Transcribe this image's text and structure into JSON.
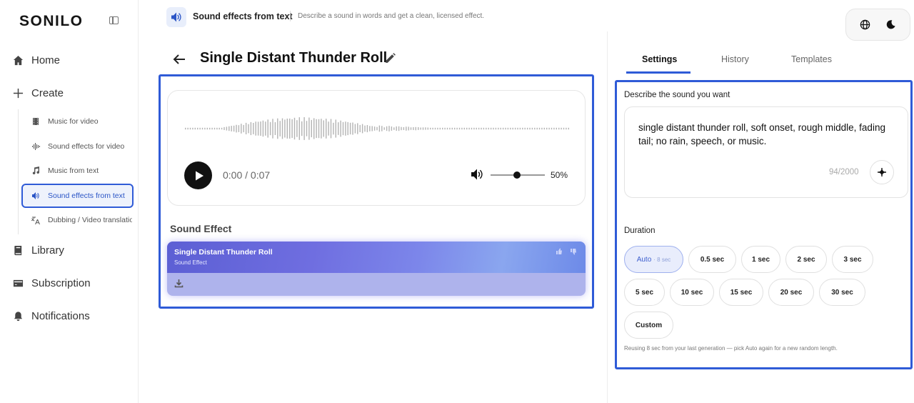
{
  "sidebar": {
    "logo": "SONILO",
    "home": "Home",
    "create": "Create",
    "sub_items": [
      {
        "label": "Music for video"
      },
      {
        "label": "Sound effects for video"
      },
      {
        "label": "Music from text"
      },
      {
        "label": "Sound effects from text"
      },
      {
        "label": "Dubbing / Video translation"
      }
    ],
    "library": "Library",
    "subscription": "Subscription",
    "notifications": "Notifications"
  },
  "header": {
    "title": "Sound effects from text",
    "description": "Describe a sound in words and get a clean, licensed effect."
  },
  "main": {
    "title": "Single Distant Thunder Roll",
    "player": {
      "time": "0:00 / 0:07",
      "volume_label": "50%",
      "volume": 0.5
    },
    "section_label": "Sound Effect",
    "card": {
      "name": "Single Distant Thunder Roll",
      "type": "Sound Effect"
    }
  },
  "panel": {
    "tabs": [
      "Settings",
      "History",
      "Templates"
    ],
    "active_tab": "Settings",
    "describe_label": "Describe the sound you want",
    "prompt": "single distant thunder roll, soft onset, rough middle, fading tail; no rain, speech, or music.",
    "char_count": "94/2000",
    "duration_label": "Duration",
    "auto_label": "Auto",
    "auto_sub": "· 8 sec",
    "durations": [
      "0.5 sec",
      "1 sec",
      "2 sec",
      "3 sec",
      "5 sec",
      "10 sec",
      "15 sec",
      "20 sec",
      "30 sec",
      "Custom"
    ],
    "hint": "Reusing 8 sec from your last generation — pick Auto again for a new random length."
  },
  "colors": {
    "accent": "#2f5bd7",
    "active_bg": "#e9edfc"
  }
}
